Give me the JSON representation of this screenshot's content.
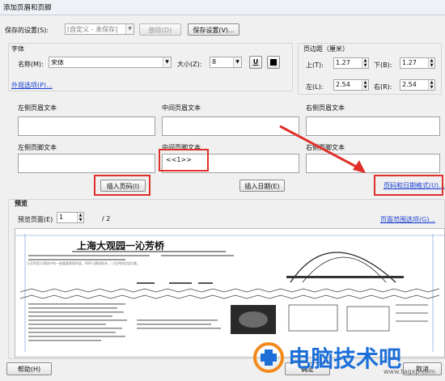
{
  "window": {
    "title": "添加页眉和页脚"
  },
  "saved_settings": {
    "label": "保存的设置(S):",
    "value": "[自定义 - 未保存]",
    "delete_button": "删除(D)",
    "save_button": "保存设置(V)..."
  },
  "font": {
    "group_label": "字体",
    "name_label": "名称(M):",
    "name_value": "宋体",
    "size_label": "大小(Z):",
    "size_value": "8",
    "underline_button": "U"
  },
  "margin": {
    "group_label": "页边距（厘米）",
    "top_label": "上(T):",
    "top_value": "1.27",
    "bottom_label": "下(B):",
    "bottom_value": "1.27",
    "left_label": "左(L):",
    "left_value": "2.54",
    "right_label": "右(R):",
    "right_value": "2.54"
  },
  "appearance_link": "外观选项(P)...",
  "headers": {
    "left_header": "左侧页眉文本",
    "center_header": "中间页眉文本",
    "right_header": "右侧页眉文本",
    "left_footer": "左侧页脚文本",
    "center_footer": "中间页脚文本",
    "right_footer": "右侧页脚文本",
    "center_footer_value": "<<1>>"
  },
  "insert_page_button": "插入页码(I)",
  "insert_date_button": "插入日期(E)",
  "page_date_format_link": "页码和日期格式(U)...",
  "preview": {
    "group_label": "预览",
    "page_label": "预览页面(E)",
    "page_value": "1",
    "page_total": "/ 2",
    "range_link": "页面范围选项(G)...",
    "doc_title": "上海大观园一沁芳桥",
    "doc_small_text": "沁芳桥是大观园中的一座重要景观桥梁，桥亭与廊相结合，三孔拱桥造型优美。"
  },
  "footer": {
    "help_button": "帮助(H)",
    "ok_button": "确定",
    "cancel_button": "取消"
  },
  "watermark": {
    "text": "电脑技术吧",
    "domain": "www.tagxp.com"
  },
  "colors": {
    "accent_red": "#e0302a",
    "link_blue": "#1a3fd1",
    "watermark_blue": "#1d6fd8"
  }
}
